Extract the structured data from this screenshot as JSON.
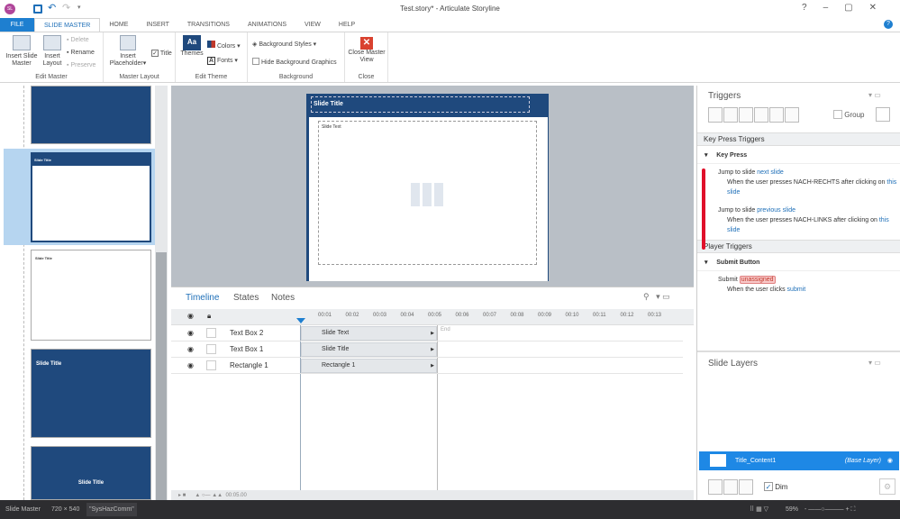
{
  "app": {
    "title": "Test.story* - Articulate Storyline",
    "logo": "SL"
  },
  "tabs": [
    "FILE",
    "SLIDE MASTER",
    "HOME",
    "INSERT",
    "TRANSITIONS",
    "ANIMATIONS",
    "VIEW",
    "HELP"
  ],
  "ribbon": {
    "edit_master": {
      "label": "Edit Master",
      "insert_slide_master": "Insert Slide Master",
      "insert_layout": "Insert Layout",
      "delete": "Delete",
      "rename": "Rename",
      "preserve": "Preserve"
    },
    "master_layout": {
      "label": "Master Layout",
      "insert_placeholder": "Insert Placeholder",
      "title": "Title",
      "title_checked": true
    },
    "edit_theme": {
      "label": "Edit Theme",
      "themes": "Themes",
      "colors": "Colors",
      "fonts": "Fonts"
    },
    "background": {
      "label": "Background",
      "background_styles": "Background Styles",
      "hide_bg": "Hide Background Graphics"
    },
    "close": {
      "label": "Close",
      "close_master": "Close Master View"
    }
  },
  "thumbnails": [
    {
      "title": ""
    },
    {
      "title": "Slide Title"
    },
    {
      "title": "Slide Title"
    },
    {
      "title": "Slide Title"
    },
    {
      "title": "Slide Title"
    }
  ],
  "slide": {
    "title": "Slide Title",
    "text": "Slide Text"
  },
  "timeline": {
    "tabs": [
      "Timeline",
      "States",
      "Notes"
    ],
    "ticks": [
      "00:01",
      "00:02",
      "00:03",
      "00:04",
      "00:05",
      "00:06",
      "00:07",
      "00:08",
      "00:09",
      "00:10",
      "00:11",
      "00:12",
      "00:13"
    ],
    "end_label": "End",
    "rows": [
      {
        "name": "Text Box 2",
        "bar": "Slide Text"
      },
      {
        "name": "Text Box 1",
        "bar": "Slide Title"
      },
      {
        "name": "Rectangle 1",
        "bar": "Rectangle 1"
      }
    ],
    "duration": "00:05.00"
  },
  "triggers": {
    "title": "Triggers",
    "group": "Group",
    "key_press_section": "Key Press Triggers",
    "key_press_group": "Key Press",
    "items": [
      {
        "action": "Jump to slide",
        "target": "next slide",
        "cond_pre": "When the user presses NACH-RECHTS after clicking on",
        "cond_obj": "this slide"
      },
      {
        "action": "Jump to slide",
        "target": "previous slide",
        "cond_pre": "When the user presses NACH-LINKS after clicking on",
        "cond_obj": "this slide"
      }
    ],
    "player_section": "Player Triggers",
    "submit_group": "Submit Button",
    "submit": {
      "action": "Submit",
      "target": "unassigned",
      "cond_pre": "When the user clicks",
      "cond_obj": "submit"
    }
  },
  "layers": {
    "title": "Slide Layers",
    "item": "Title_Content1",
    "base": "(Base Layer)",
    "dim": "Dim",
    "dim_checked": true
  },
  "status": {
    "mode": "Slide Master",
    "size": "720 × 540",
    "theme": "\"SysHazComm\"",
    "zoom": "59%"
  }
}
